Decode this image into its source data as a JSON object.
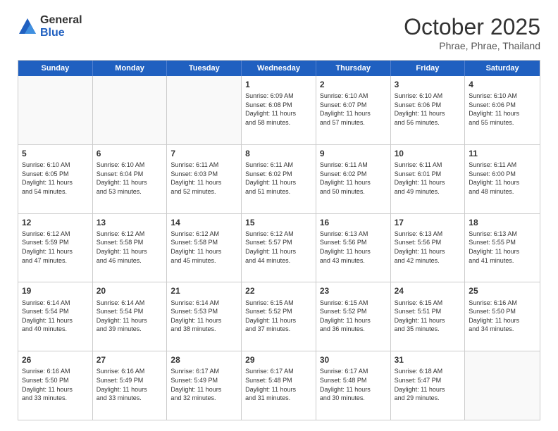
{
  "header": {
    "logo_general": "General",
    "logo_blue": "Blue",
    "month_title": "October 2025",
    "subtitle": "Phrae, Phrae, Thailand"
  },
  "weekdays": [
    "Sunday",
    "Monday",
    "Tuesday",
    "Wednesday",
    "Thursday",
    "Friday",
    "Saturday"
  ],
  "rows": [
    [
      {
        "day": "",
        "text": ""
      },
      {
        "day": "",
        "text": ""
      },
      {
        "day": "",
        "text": ""
      },
      {
        "day": "1",
        "text": "Sunrise: 6:09 AM\nSunset: 6:08 PM\nDaylight: 11 hours\nand 58 minutes."
      },
      {
        "day": "2",
        "text": "Sunrise: 6:10 AM\nSunset: 6:07 PM\nDaylight: 11 hours\nand 57 minutes."
      },
      {
        "day": "3",
        "text": "Sunrise: 6:10 AM\nSunset: 6:06 PM\nDaylight: 11 hours\nand 56 minutes."
      },
      {
        "day": "4",
        "text": "Sunrise: 6:10 AM\nSunset: 6:06 PM\nDaylight: 11 hours\nand 55 minutes."
      }
    ],
    [
      {
        "day": "5",
        "text": "Sunrise: 6:10 AM\nSunset: 6:05 PM\nDaylight: 11 hours\nand 54 minutes."
      },
      {
        "day": "6",
        "text": "Sunrise: 6:10 AM\nSunset: 6:04 PM\nDaylight: 11 hours\nand 53 minutes."
      },
      {
        "day": "7",
        "text": "Sunrise: 6:11 AM\nSunset: 6:03 PM\nDaylight: 11 hours\nand 52 minutes."
      },
      {
        "day": "8",
        "text": "Sunrise: 6:11 AM\nSunset: 6:02 PM\nDaylight: 11 hours\nand 51 minutes."
      },
      {
        "day": "9",
        "text": "Sunrise: 6:11 AM\nSunset: 6:02 PM\nDaylight: 11 hours\nand 50 minutes."
      },
      {
        "day": "10",
        "text": "Sunrise: 6:11 AM\nSunset: 6:01 PM\nDaylight: 11 hours\nand 49 minutes."
      },
      {
        "day": "11",
        "text": "Sunrise: 6:11 AM\nSunset: 6:00 PM\nDaylight: 11 hours\nand 48 minutes."
      }
    ],
    [
      {
        "day": "12",
        "text": "Sunrise: 6:12 AM\nSunset: 5:59 PM\nDaylight: 11 hours\nand 47 minutes."
      },
      {
        "day": "13",
        "text": "Sunrise: 6:12 AM\nSunset: 5:58 PM\nDaylight: 11 hours\nand 46 minutes."
      },
      {
        "day": "14",
        "text": "Sunrise: 6:12 AM\nSunset: 5:58 PM\nDaylight: 11 hours\nand 45 minutes."
      },
      {
        "day": "15",
        "text": "Sunrise: 6:12 AM\nSunset: 5:57 PM\nDaylight: 11 hours\nand 44 minutes."
      },
      {
        "day": "16",
        "text": "Sunrise: 6:13 AM\nSunset: 5:56 PM\nDaylight: 11 hours\nand 43 minutes."
      },
      {
        "day": "17",
        "text": "Sunrise: 6:13 AM\nSunset: 5:56 PM\nDaylight: 11 hours\nand 42 minutes."
      },
      {
        "day": "18",
        "text": "Sunrise: 6:13 AM\nSunset: 5:55 PM\nDaylight: 11 hours\nand 41 minutes."
      }
    ],
    [
      {
        "day": "19",
        "text": "Sunrise: 6:14 AM\nSunset: 5:54 PM\nDaylight: 11 hours\nand 40 minutes."
      },
      {
        "day": "20",
        "text": "Sunrise: 6:14 AM\nSunset: 5:54 PM\nDaylight: 11 hours\nand 39 minutes."
      },
      {
        "day": "21",
        "text": "Sunrise: 6:14 AM\nSunset: 5:53 PM\nDaylight: 11 hours\nand 38 minutes."
      },
      {
        "day": "22",
        "text": "Sunrise: 6:15 AM\nSunset: 5:52 PM\nDaylight: 11 hours\nand 37 minutes."
      },
      {
        "day": "23",
        "text": "Sunrise: 6:15 AM\nSunset: 5:52 PM\nDaylight: 11 hours\nand 36 minutes."
      },
      {
        "day": "24",
        "text": "Sunrise: 6:15 AM\nSunset: 5:51 PM\nDaylight: 11 hours\nand 35 minutes."
      },
      {
        "day": "25",
        "text": "Sunrise: 6:16 AM\nSunset: 5:50 PM\nDaylight: 11 hours\nand 34 minutes."
      }
    ],
    [
      {
        "day": "26",
        "text": "Sunrise: 6:16 AM\nSunset: 5:50 PM\nDaylight: 11 hours\nand 33 minutes."
      },
      {
        "day": "27",
        "text": "Sunrise: 6:16 AM\nSunset: 5:49 PM\nDaylight: 11 hours\nand 33 minutes."
      },
      {
        "day": "28",
        "text": "Sunrise: 6:17 AM\nSunset: 5:49 PM\nDaylight: 11 hours\nand 32 minutes."
      },
      {
        "day": "29",
        "text": "Sunrise: 6:17 AM\nSunset: 5:48 PM\nDaylight: 11 hours\nand 31 minutes."
      },
      {
        "day": "30",
        "text": "Sunrise: 6:17 AM\nSunset: 5:48 PM\nDaylight: 11 hours\nand 30 minutes."
      },
      {
        "day": "31",
        "text": "Sunrise: 6:18 AM\nSunset: 5:47 PM\nDaylight: 11 hours\nand 29 minutes."
      },
      {
        "day": "",
        "text": ""
      }
    ]
  ]
}
